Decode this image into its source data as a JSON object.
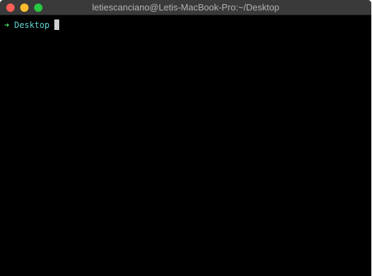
{
  "window": {
    "title": "letiescanciano@Letis-MacBook-Pro:~/Desktop"
  },
  "terminal": {
    "prompt_arrow": "➜",
    "current_directory": "Desktop",
    "input": ""
  },
  "colors": {
    "background": "#000000",
    "prompt_arrow": "#4fe36a",
    "directory": "#5fd7d7",
    "cursor": "#cfcfcf"
  }
}
